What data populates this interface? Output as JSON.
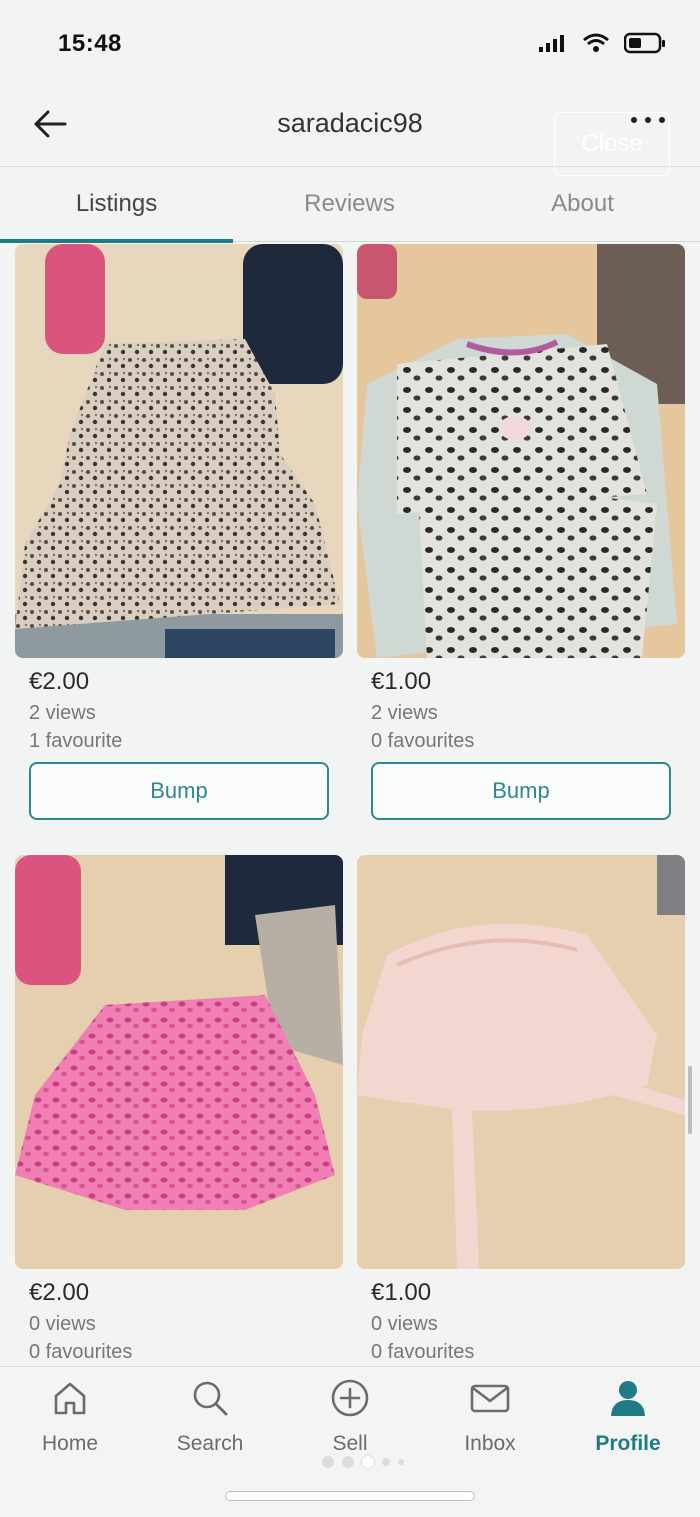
{
  "status_bar": {
    "time": "15:48"
  },
  "header": {
    "username": "saradacic98",
    "close_label": "Close"
  },
  "tabs": [
    {
      "label": "Listings",
      "active": true
    },
    {
      "label": "Reviews",
      "active": false
    },
    {
      "label": "About",
      "active": false
    }
  ],
  "listings": [
    {
      "price": "€2.00",
      "views": "2 views",
      "favourites": "1 favourite",
      "bump_label": "Bump",
      "photo_desc": "floral-dress-photo"
    },
    {
      "price": "€1.00",
      "views": "2 views",
      "favourites": "0 favourites",
      "bump_label": "Bump",
      "photo_desc": "leopard-top-photo"
    },
    {
      "price": "€2.00",
      "views": "0 views",
      "favourites": "0 favourites",
      "photo_desc": "pink-skirt-photo"
    },
    {
      "price": "€1.00",
      "views": "0 views",
      "favourites": "0 favourites",
      "photo_desc": "pink-hat-photo"
    }
  ],
  "bottom_nav": [
    {
      "label": "Home",
      "icon": "home-icon",
      "active": false
    },
    {
      "label": "Search",
      "icon": "search-icon",
      "active": false
    },
    {
      "label": "Sell",
      "icon": "plus-circle-icon",
      "active": false
    },
    {
      "label": "Inbox",
      "icon": "mail-icon",
      "active": false
    },
    {
      "label": "Profile",
      "icon": "person-icon",
      "active": true
    }
  ],
  "colors": {
    "accent": "#1f7c85",
    "background": "#f2f3f3"
  }
}
